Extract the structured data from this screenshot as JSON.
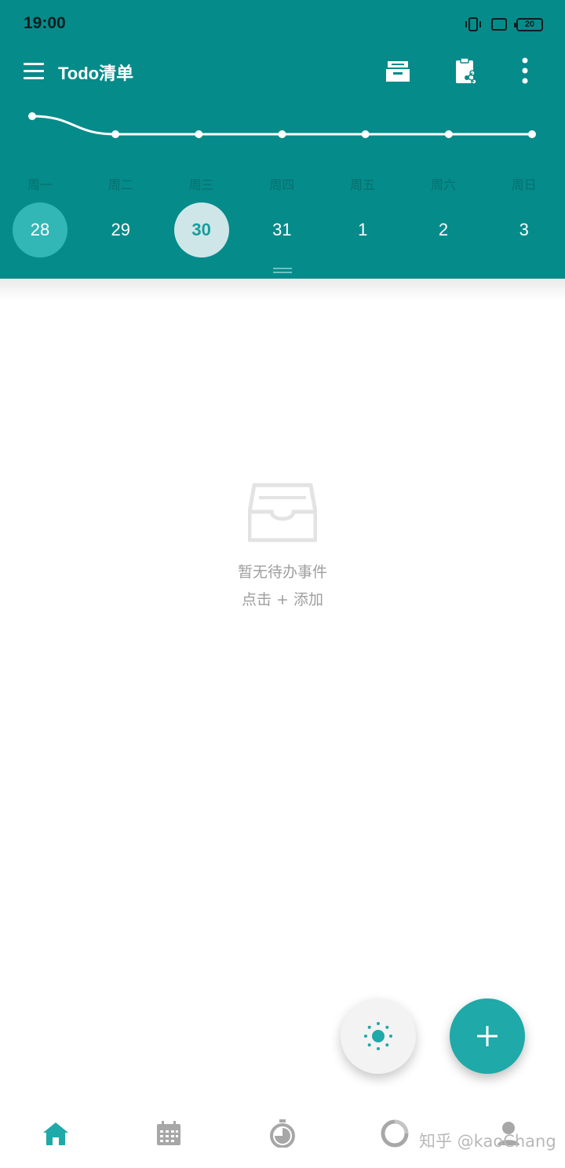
{
  "status_bar": {
    "time": "19:00",
    "battery": "20"
  },
  "header": {
    "title": "Todo清单",
    "actions": [
      "inbox-icon",
      "clipboard-share-icon",
      "more-vert-icon"
    ]
  },
  "week": {
    "weekdays": [
      "周一",
      "周二",
      "周三",
      "周四",
      "周五",
      "周六",
      "周日"
    ],
    "dates": [
      "28",
      "29",
      "30",
      "31",
      "1",
      "2",
      "3"
    ],
    "today_index": 0,
    "selected_index": 2
  },
  "chart_data": {
    "type": "line",
    "categories": [
      "周一",
      "周二",
      "周三",
      "周四",
      "周五",
      "周六",
      "周日"
    ],
    "series": [
      {
        "values": [
          2,
          0,
          0,
          0,
          0,
          0,
          0
        ]
      }
    ],
    "color": "#ffffff",
    "grid": false
  },
  "empty_state": {
    "icon": "empty-inbox-icon",
    "title": "暂无待办事件",
    "hint": "点击 + 添加"
  },
  "fabs": {
    "theme_icon": "sun-icon",
    "add_icon": "plus-icon"
  },
  "bottom_nav": [
    {
      "icon": "home-icon",
      "active": true
    },
    {
      "icon": "calendar-icon",
      "active": false
    },
    {
      "icon": "timer-icon",
      "active": false
    },
    {
      "icon": "ring-chart-icon",
      "active": false
    },
    {
      "icon": "profile-icon",
      "active": false
    }
  ],
  "watermark": "知乎 @kaoChang",
  "colors": {
    "primary": "#058b8a",
    "accent": "#1fa9a8",
    "today_circle": "#33b7b6",
    "selected_circle": "#cfe6e8",
    "muted_text": "#9e9e9e"
  }
}
